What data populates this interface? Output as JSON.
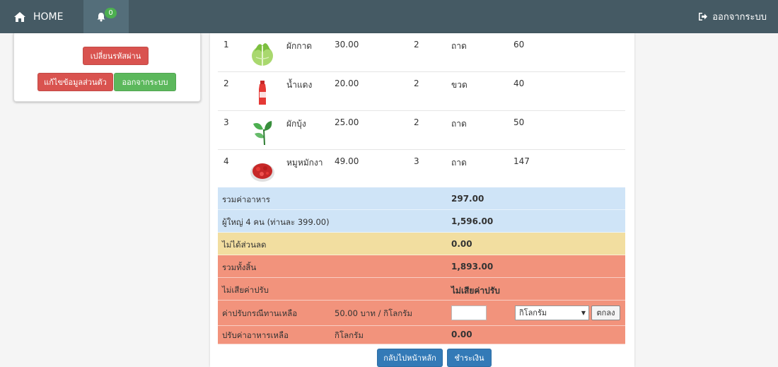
{
  "navbar": {
    "home_label": "HOME",
    "notification_count": "0",
    "logout_label": "ออกจากระบบ"
  },
  "sidebar": {
    "change_password": "เปลี่ยนรหัสผ่าน",
    "edit_profile": "แก้ไขข้อมูลส่วนตัว",
    "logout": "ออกจากระบบ"
  },
  "order": {
    "items": [
      {
        "no": "1",
        "name": "ผักกาด",
        "price": "30.00",
        "qty": "2",
        "unit": "ถาด",
        "total": "60",
        "icon": "lettuce-image"
      },
      {
        "no": "2",
        "name": "น้ำแดง",
        "price": "20.00",
        "qty": "2",
        "unit": "ขวด",
        "total": "40",
        "icon": "red-drink-image"
      },
      {
        "no": "3",
        "name": "ผักบุ้ง",
        "price": "25.00",
        "qty": "2",
        "unit": "ถาด",
        "total": "50",
        "icon": "morning-glory-image"
      },
      {
        "no": "4",
        "name": "หมูหมักงา",
        "price": "49.00",
        "qty": "3",
        "unit": "ถาด",
        "total": "147",
        "icon": "marinated-pork-image"
      }
    ],
    "food_total_label": "รวมค่าอาหาร",
    "food_total_value": "297.00",
    "adults_label": "ผู้ใหญ่ 4 คน (ท่านละ 399.00)",
    "adults_value": "1,596.00",
    "discount_label": "ไม่ได้ส่วนลด",
    "discount_value": "0.00",
    "grand_total_label": "รวมทั้งสิ้น",
    "grand_total_value": "1,893.00",
    "fine_label": "ไม่เสียค่าปรับ",
    "fine_value": "ไม่เสียค่าปรับ",
    "leftover_label": "ค่าปรับกรณีทานเหลือ",
    "leftover_rate": "50.00 บาท / กิโลกรัม",
    "leftover_input_value": "",
    "unit_selected": "กิโลกรัม",
    "ok_label": "ตกลง",
    "leftover_fine_label": "ปรับค่าอาหารเหลือ",
    "leftover_fine_unit": "กิโลกรัม",
    "leftover_fine_value": "0.00"
  },
  "actions": {
    "back_home": "กลับไปหน้าหลัก",
    "pay": "ชำระเงิน"
  },
  "colors": {
    "navbar": "#455a64",
    "summary_blue": "#cfe4f7",
    "summary_yellow": "#f2dea0",
    "summary_red": "#f2937c",
    "btn_red": "#d9534f",
    "btn_green": "#5cb85c",
    "btn_blue": "#337ab7"
  }
}
